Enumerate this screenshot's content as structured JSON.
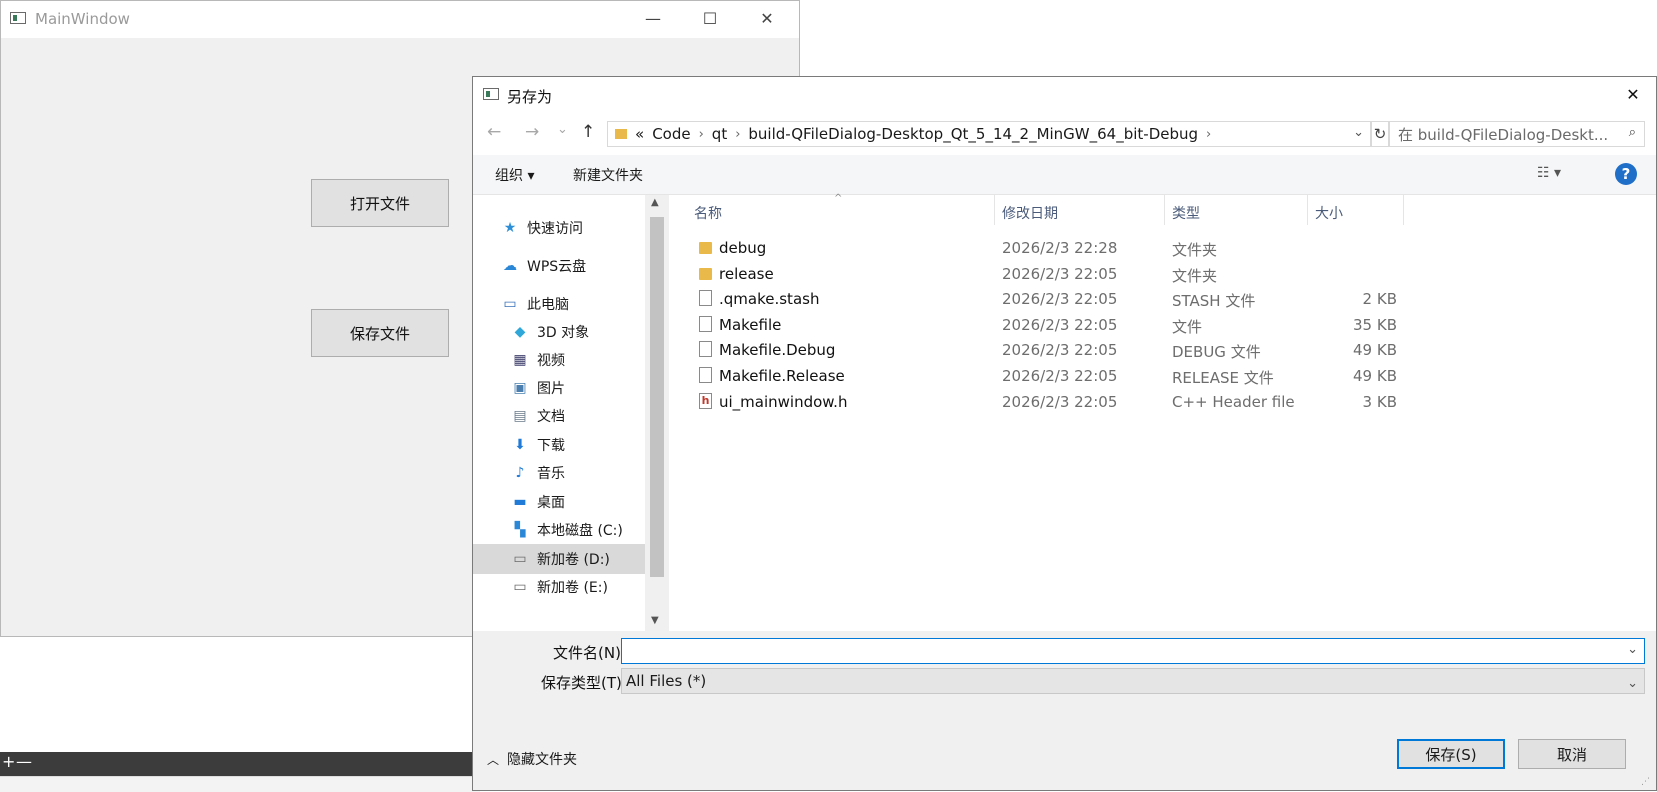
{
  "main_window": {
    "title": "MainWindow",
    "open_file_label": "打开文件",
    "save_file_label": "保存文件",
    "caption_min": "—",
    "caption_max": "☐",
    "caption_close": "✕"
  },
  "taskstrip": {
    "plus": "+",
    "minus": "—"
  },
  "dialog": {
    "title": "另存为",
    "close": "✕",
    "nav": {
      "back": "←",
      "forward": "→",
      "recent": "⌄",
      "up": "↑"
    },
    "address": {
      "prefix": "«",
      "segments": [
        "Code",
        "qt",
        "build-QFileDialog-Desktop_Qt_5_14_2_MinGW_64_bit-Debug"
      ],
      "refresh": "↻"
    },
    "search_placeholder": "在 build-QFileDialog-Deskt...",
    "toolbar": {
      "organize": "组织 ▾",
      "new_folder": "新建文件夹",
      "view": "☷ ▾",
      "help": "?"
    },
    "nav_pane": [
      {
        "label": "快速访问",
        "icon": "star-icon",
        "glyph": "★",
        "color": "#2d8fd8"
      },
      {
        "label": "WPS云盘",
        "icon": "cloud-icon",
        "glyph": "☁",
        "color": "#2a86d6"
      },
      {
        "label": "此电脑",
        "icon": "computer-icon",
        "glyph": "▭",
        "color": "#3a72b8"
      },
      {
        "label": "3D 对象",
        "icon": "cube-icon",
        "glyph": "◆",
        "color": "#2fa7d8"
      },
      {
        "label": "视频",
        "icon": "film-icon",
        "glyph": "▦",
        "color": "#3d3d6b"
      },
      {
        "label": "图片",
        "icon": "picture-icon",
        "glyph": "▣",
        "color": "#4a7fb0"
      },
      {
        "label": "文档",
        "icon": "document-icon",
        "glyph": "▤",
        "color": "#6a7a8a"
      },
      {
        "label": "下载",
        "icon": "download-icon",
        "glyph": "⬇",
        "color": "#1f7ad8"
      },
      {
        "label": "音乐",
        "icon": "music-icon",
        "glyph": "♪",
        "color": "#1f7ad8"
      },
      {
        "label": "桌面",
        "icon": "desktop-icon",
        "glyph": "▬",
        "color": "#1f7ad8"
      },
      {
        "label": "本地磁盘 (C:)",
        "icon": "windows-drive-icon",
        "glyph": "▚",
        "color": "#2a86d6"
      },
      {
        "label": "新加卷 (D:)",
        "icon": "drive-icon",
        "glyph": "▭",
        "color": "#6a6a6a"
      },
      {
        "label": "新加卷 (E:)",
        "icon": "drive-icon",
        "glyph": "▭",
        "color": "#6a6a6a"
      }
    ],
    "columns": {
      "name": "名称",
      "date": "修改日期",
      "type": "类型",
      "size": "大小"
    },
    "files": [
      {
        "name": "debug",
        "date": "2026/2/3 22:28",
        "type": "文件夹",
        "size": "",
        "kind": "folder"
      },
      {
        "name": "release",
        "date": "2026/2/3 22:05",
        "type": "文件夹",
        "size": "",
        "kind": "folder"
      },
      {
        "name": ".qmake.stash",
        "date": "2026/2/3 22:05",
        "type": "STASH 文件",
        "size": "2 KB",
        "kind": "file"
      },
      {
        "name": "Makefile",
        "date": "2026/2/3 22:05",
        "type": "文件",
        "size": "35 KB",
        "kind": "file"
      },
      {
        "name": "Makefile.Debug",
        "date": "2026/2/3 22:05",
        "type": "DEBUG 文件",
        "size": "49 KB",
        "kind": "file"
      },
      {
        "name": "Makefile.Release",
        "date": "2026/2/3 22:05",
        "type": "RELEASE 文件",
        "size": "49 KB",
        "kind": "file"
      },
      {
        "name": "ui_mainwindow.h",
        "date": "2026/2/3 22:05",
        "type": "C++ Header file",
        "size": "3 KB",
        "kind": "header"
      }
    ],
    "filename_label": "文件名(N):",
    "filename_value": "",
    "filetype_label": "保存类型(T):",
    "filetype_value": "All Files  (*)",
    "hide_folders": "隐藏文件夹",
    "save_label": "保存(S)",
    "cancel_label": "取消"
  }
}
